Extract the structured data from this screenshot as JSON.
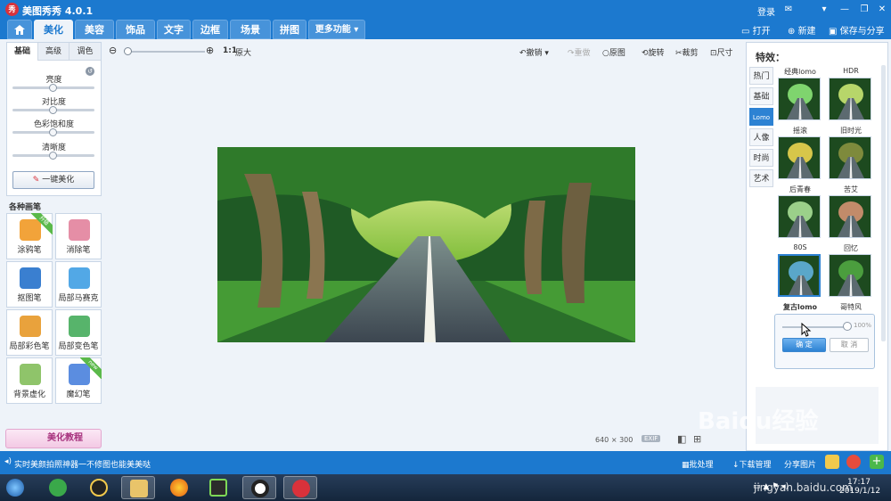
{
  "window": {
    "title": "美图秀秀 4.0.1",
    "logo_text": "秀",
    "login": "登录"
  },
  "menu": {
    "tabs": [
      "美化",
      "美容",
      "饰品",
      "文字",
      "边框",
      "场景",
      "拼图",
      "更多功能 ▾"
    ],
    "right": {
      "open": "打开",
      "new": "新建",
      "save": "保存与分享"
    }
  },
  "left_panel": {
    "subtabs": [
      "基础",
      "高级",
      "调色"
    ],
    "sliders": [
      {
        "label": "亮度",
        "value": 0.5
      },
      {
        "label": "对比度",
        "value": 0.5
      },
      {
        "label": "色彩饱和度",
        "value": 0.5
      },
      {
        "label": "清晰度",
        "value": 0.5
      }
    ],
    "one_click": "一键美化",
    "brush_title": "各种画笔",
    "brushes": [
      {
        "label": "涂鸦笔",
        "badge": "升级",
        "color": "#f2a33a"
      },
      {
        "label": "消除笔",
        "badge": "",
        "color": "#e58ea6"
      },
      {
        "label": "抠图笔",
        "badge": "",
        "color": "#3a7fd0"
      },
      {
        "label": "局部马赛克",
        "badge": "",
        "color": "#52a8e6"
      },
      {
        "label": "局部彩色笔",
        "badge": "",
        "color": "#e9a23c"
      },
      {
        "label": "局部变色笔",
        "badge": "",
        "color": "#57b46b"
      },
      {
        "label": "背景虚化",
        "badge": "",
        "color": "#8fc46a"
      },
      {
        "label": "魔幻笔",
        "badge": "new",
        "color": "#5b8de0"
      }
    ],
    "tutorial": "美化教程"
  },
  "toolbar": {
    "ratio": "1:1",
    "original_size": "原大",
    "undo": "撤销",
    "redo": "重做",
    "original": "原图",
    "rotate": "旋转",
    "crop": "裁剪",
    "resize": "尺寸"
  },
  "image_info": {
    "width": "640",
    "times": "×",
    "height": "300",
    "exif": "EXIF"
  },
  "right_panel": {
    "header": "特效：",
    "categories": [
      "热门",
      "基础",
      "Lomo",
      "人像",
      "时尚",
      "艺术"
    ],
    "active_category": 2,
    "effects": [
      {
        "name": "经典lomo"
      },
      {
        "name": "HDR"
      },
      {
        "name": "摇滚"
      },
      {
        "name": "旧时光"
      },
      {
        "name": "后青春"
      },
      {
        "name": "苦艾"
      },
      {
        "name": "80S"
      },
      {
        "name": "回忆"
      },
      {
        "name": "复古lomo"
      },
      {
        "name": "哥特风"
      }
    ],
    "selected_effect": 8,
    "strength": "100%",
    "confirm": "确 定",
    "cancel": "取 消"
  },
  "status": {
    "message": "实时美颜拍照神器一不修图也能美美哒",
    "batch": "批处理",
    "download": "下载管理",
    "share": "分享图片"
  },
  "taskbar": {
    "time": "17:17",
    "date": "2019/1/12"
  },
  "watermark": {
    "logo": "Baidu经验",
    "url": "jingyan.baidu.com"
  }
}
